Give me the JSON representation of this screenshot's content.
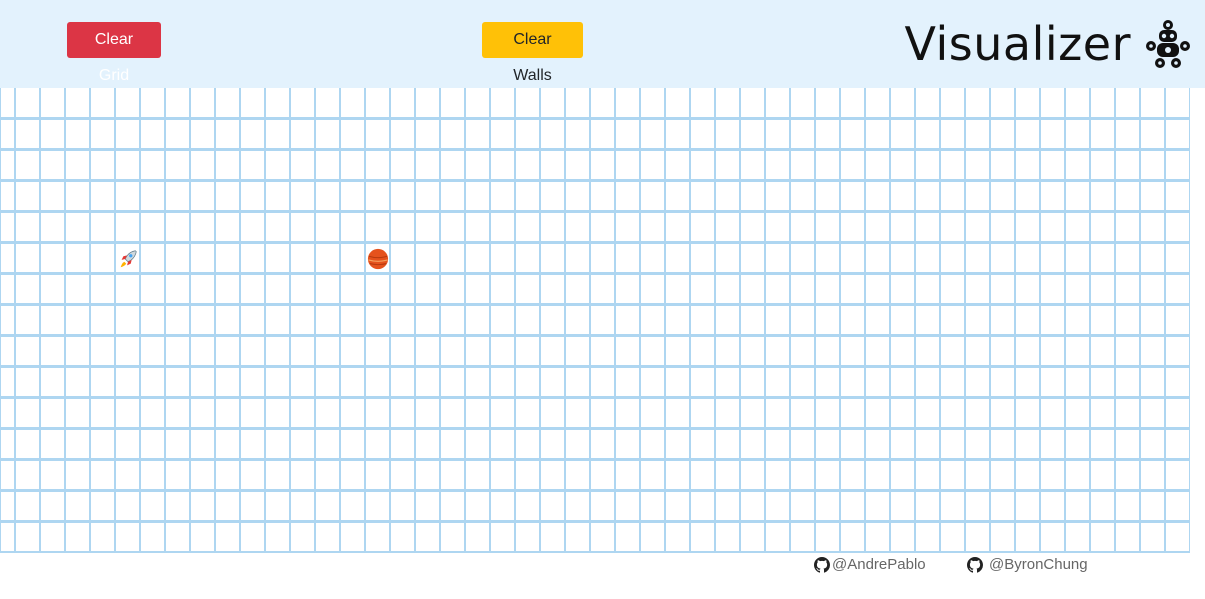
{
  "header": {
    "clear_grid_label": "Clear Grid",
    "clear_walls_label": "Clear Walls",
    "title": "Visualizer",
    "logo_icon": "robot-icon"
  },
  "colors": {
    "header_bg": "#e3f2fd",
    "clear_grid_bg": "#dc3545",
    "clear_walls_bg": "#ffc107",
    "cell_border": "#aed6f1"
  },
  "grid": {
    "rows": 15,
    "columns": 48,
    "start": {
      "row": 5,
      "col": 5,
      "icon": "rocket-icon"
    },
    "target": {
      "row": 5,
      "col": 15,
      "icon": "planet-icon"
    }
  },
  "footer": {
    "links": [
      {
        "label": "@AndrePablo",
        "icon": "github-icon"
      },
      {
        "label": "@ByronChung",
        "icon": "github-icon"
      }
    ]
  }
}
